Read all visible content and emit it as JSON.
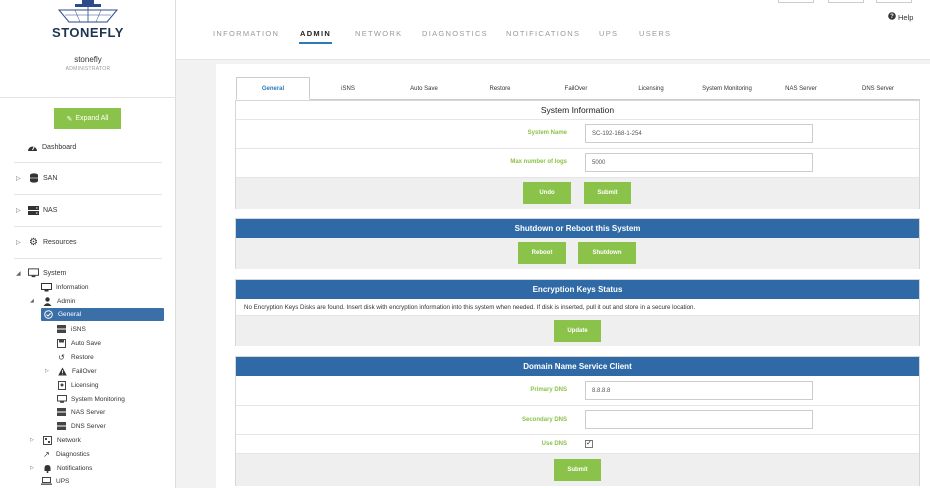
{
  "brand": {
    "name": "STONEFLY",
    "user": "stonefly",
    "role": "ADMINISTRATOR"
  },
  "sidebar": {
    "expand_all": "Expand All",
    "dashboard": "Dashboard",
    "san": "SAN",
    "nas": "NAS",
    "resources": "Resources",
    "system": "System",
    "information": "Information",
    "admin": "Admin",
    "admin_items": [
      "General",
      "iSNS",
      "Auto Save",
      "Restore",
      "FailOver",
      "Licensing",
      "System Monitoring",
      "NAS Server",
      "DNS Server"
    ],
    "network": "Network",
    "diagnostics": "Diagnostics",
    "notifications": "Notifications",
    "ups": "UPS"
  },
  "topnav": {
    "tabs": [
      "INFORMATION",
      "ADMIN",
      "NETWORK",
      "DIAGNOSTICS",
      "NOTIFICATIONS",
      "UPS",
      "USERS"
    ],
    "active": "ADMIN",
    "help": "Help"
  },
  "subtabs": [
    "General",
    "iSNS",
    "Auto Save",
    "Restore",
    "FailOver",
    "Licensing",
    "System Monitoring",
    "NAS Server",
    "DNS Server"
  ],
  "system_info": {
    "title": "System Information",
    "system_name_label": "System Name",
    "system_name_value": "SC-192-168-1-254",
    "max_logs_label": "Max number of logs",
    "max_logs_value": "5000",
    "undo": "Undo",
    "submit": "Submit"
  },
  "shutdown": {
    "title": "Shutdown or Reboot this System",
    "reboot": "Reboot",
    "shutdown": "Shutdown"
  },
  "encryption": {
    "title": "Encryption Keys Status",
    "message": "No Encryption Keys Disks are found. Insert disk with encryption information into this system when needed. If disk is inserted, pull it out and store in a secure location.",
    "update": "Update"
  },
  "dns": {
    "title": "Domain Name Service Client",
    "primary_label": "Primary DNS",
    "primary_value": "8.8.8.8",
    "secondary_label": "Secondary DNS",
    "secondary_value": "",
    "use_dns_label": "Use DNS",
    "use_dns_checked": true,
    "submit": "Submit"
  },
  "colors": {
    "accent_green": "#8bc34a",
    "header_blue": "#2f6aa6",
    "active_blue": "#3a6fa8"
  }
}
